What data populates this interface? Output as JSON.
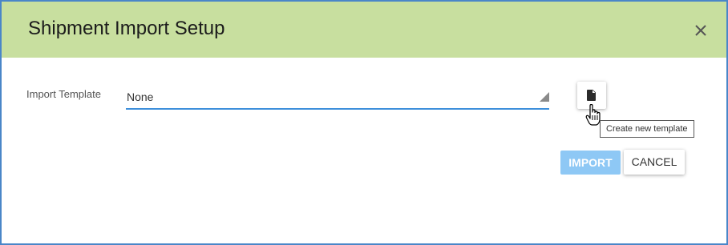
{
  "dialog": {
    "title": "Shipment Import Setup",
    "header_color": "#c8df9f",
    "border_color": "#4a86c8",
    "close_icon": "close-icon"
  },
  "form": {
    "template_label": "Import Template",
    "template_value": "None",
    "dropdown_icon": "triangle-dropdown-icon",
    "underline_color": "#3d8fdb",
    "new_template_icon": "document-icon",
    "new_template_tooltip": "Create new template"
  },
  "actions": {
    "import_label": "IMPORT",
    "import_color": "#8ec8f5",
    "cancel_label": "CANCEL"
  }
}
